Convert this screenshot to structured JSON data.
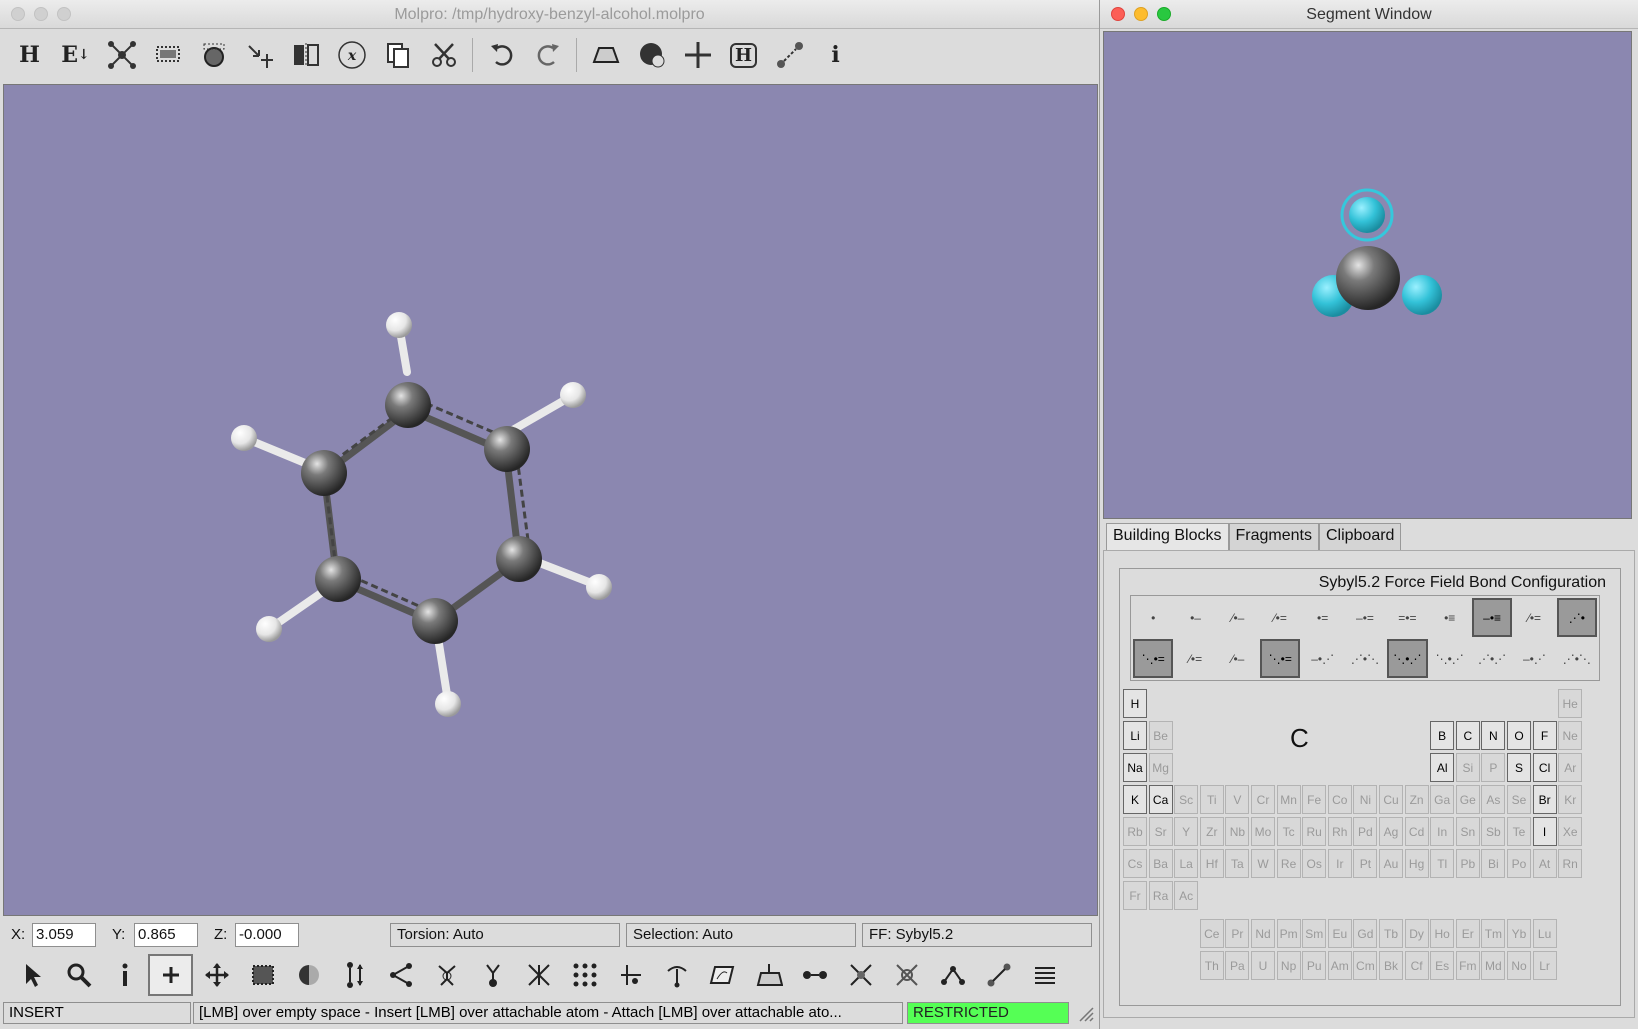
{
  "main_window": {
    "title": "Molpro: /tmp/hydroxy-benzyl-alcohol.molpro",
    "toolbar": [
      {
        "name": "hydrogen-tool-button",
        "icon": "H",
        "glyph": "H"
      },
      {
        "name": "element-tool-button",
        "icon": "E",
        "glyph": "E"
      },
      {
        "name": "clean-geometry-button",
        "icon": "clean-geometry-icon",
        "glyph": ""
      },
      {
        "name": "select-grid-button",
        "icon": "grid-icon",
        "glyph": ""
      },
      {
        "name": "rotate-view-button",
        "icon": "rotate-icon",
        "glyph": ""
      },
      {
        "name": "arrange-button",
        "icon": "arrange-icon",
        "glyph": ""
      },
      {
        "name": "symmetry-button",
        "icon": "symmetry-icon",
        "glyph": ""
      },
      {
        "name": "function-button",
        "icon": "function-icon",
        "glyph": "(x)"
      },
      {
        "name": "copy-button",
        "icon": "copy-icon",
        "glyph": ""
      },
      {
        "name": "cut-button",
        "icon": "scissors-icon",
        "glyph": ""
      },
      {
        "name": "undo-button",
        "icon": "undo-icon",
        "glyph": ""
      },
      {
        "name": "redo-button",
        "icon": "redo-icon",
        "glyph": ""
      },
      {
        "name": "surface-button",
        "icon": "surface-icon",
        "glyph": ""
      },
      {
        "name": "sphere-button",
        "icon": "sphere-icon",
        "glyph": ""
      },
      {
        "name": "center-button",
        "icon": "crosshair-icon",
        "glyph": ""
      },
      {
        "name": "hydrogen-bond-button",
        "icon": "H",
        "glyph": "H"
      },
      {
        "name": "bond-button",
        "icon": "bond-icon",
        "glyph": ""
      },
      {
        "name": "info-button",
        "icon": "info-icon",
        "glyph": "i"
      }
    ],
    "coords": {
      "x_label": "X:",
      "x": "3.059",
      "y_label": "Y:",
      "y": "0.865",
      "z_label": "Z:",
      "z": "-0.000"
    },
    "fields": {
      "torsion": "Torsion: Auto",
      "selection": "Selection: Auto",
      "ff": "FF: Sybyl5.2"
    },
    "status": {
      "mode": "INSERT",
      "hint": "[LMB] over empty space - Insert  [LMB] over attachable atom - Attach  [LMB] over attachable ato...",
      "restriction": "RESTRICTED"
    },
    "colors": {
      "viewport": "#8b87b0",
      "restricted": "#55ff55"
    }
  },
  "segment_window": {
    "title": "Segment Window",
    "tabs": [
      "Building Blocks",
      "Fragments",
      "Clipboard"
    ],
    "panel_title": "Sybyl5.2 Force Field Bond Configuration",
    "selected_element": "C",
    "periodic_table": {
      "enabled": [
        "H",
        "Li",
        "Na",
        "K",
        "Ca",
        "B",
        "C",
        "N",
        "O",
        "F",
        "Al",
        "S",
        "Cl",
        "Br",
        "I"
      ]
    }
  }
}
